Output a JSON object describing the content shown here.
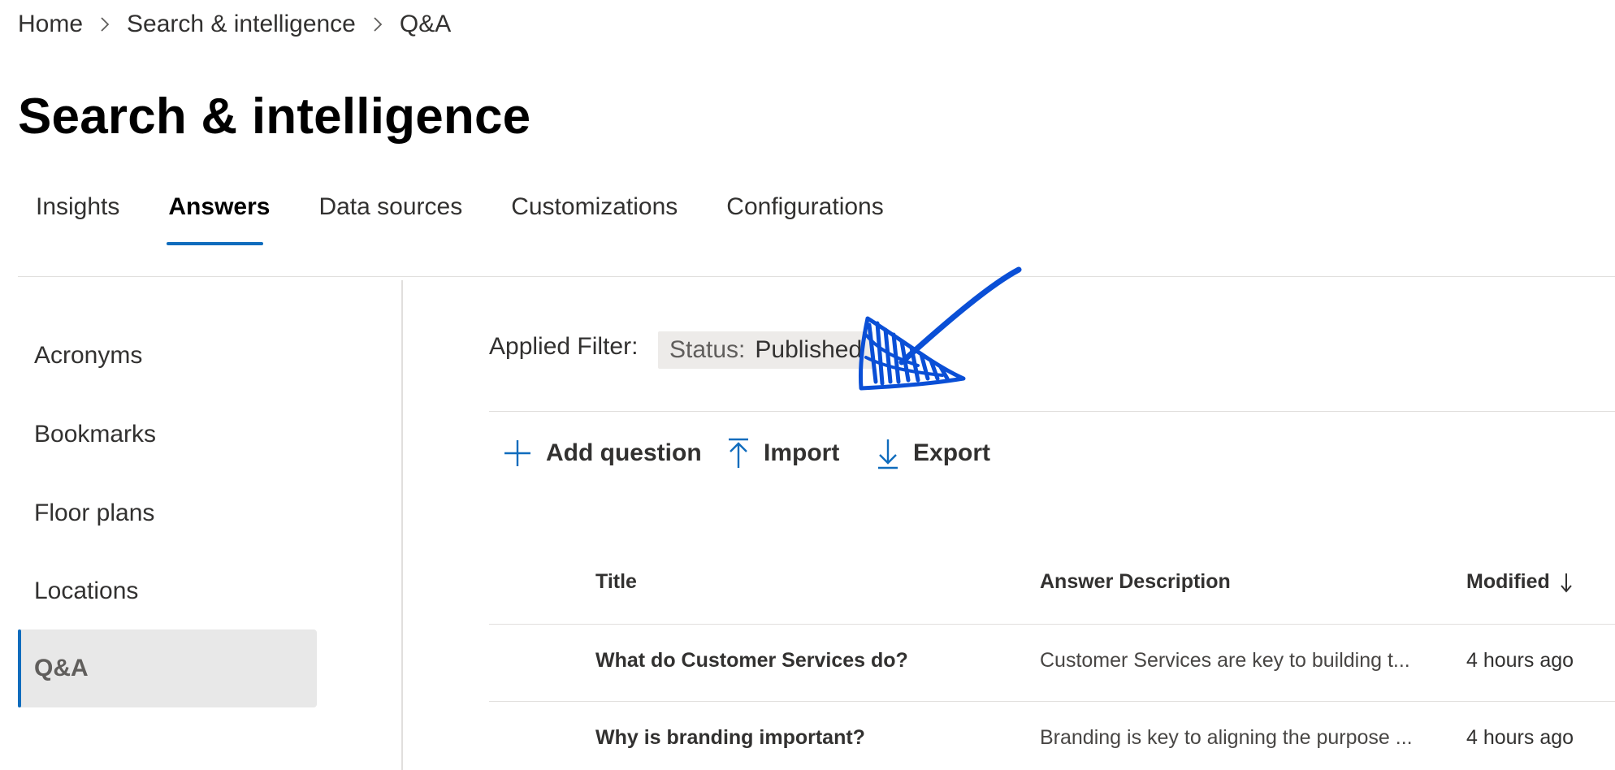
{
  "breadcrumb": {
    "items": [
      "Home",
      "Search & intelligence",
      "Q&A"
    ]
  },
  "page": {
    "title": "Search & intelligence"
  },
  "tabs": [
    {
      "label": "Insights"
    },
    {
      "label": "Answers",
      "active": true
    },
    {
      "label": "Data sources"
    },
    {
      "label": "Customizations"
    },
    {
      "label": "Configurations"
    }
  ],
  "sidebar": {
    "items": [
      {
        "label": "Acronyms"
      },
      {
        "label": "Bookmarks"
      },
      {
        "label": "Floor plans"
      },
      {
        "label": "Locations"
      },
      {
        "label": "Q&A",
        "selected": true
      }
    ]
  },
  "filter": {
    "label": "Applied Filter:",
    "key": "Status:",
    "value": "Published"
  },
  "commands": {
    "add": {
      "label": "Add question",
      "icon": "plus-icon"
    },
    "import": {
      "label": "Import",
      "icon": "upload-icon"
    },
    "export": {
      "label": "Export",
      "icon": "download-icon"
    }
  },
  "table": {
    "columns": {
      "title": "Title",
      "description": "Answer Description",
      "modified": "Modified"
    },
    "sort": {
      "column": "Modified",
      "direction": "descending"
    },
    "rows": [
      {
        "title": "What do Customer Services do?",
        "description": "Customer Services are key to building t...",
        "modified": "4 hours ago"
      },
      {
        "title": "Why is branding important?",
        "description": "Branding is key to aligning the purpose ...",
        "modified": "4 hours ago"
      }
    ]
  },
  "colors": {
    "accent": "#0f6cbd",
    "annotation": "#0a4fd6",
    "selected_bg": "#e8e8e8"
  }
}
